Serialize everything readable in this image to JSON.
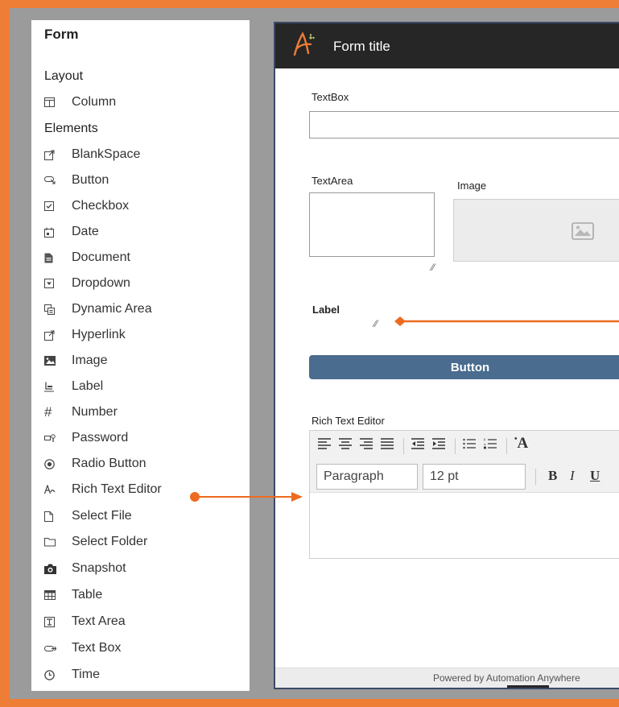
{
  "sidebar": {
    "title": "Form",
    "layout_label": "Layout",
    "layout_items": [
      {
        "label": "Column",
        "icon": "column-icon"
      }
    ],
    "elements_label": "Elements",
    "element_items": [
      {
        "label": "BlankSpace",
        "icon": "blankspace-icon"
      },
      {
        "label": "Button",
        "icon": "button-icon"
      },
      {
        "label": "Checkbox",
        "icon": "checkbox-icon"
      },
      {
        "label": "Date",
        "icon": "calendar-icon"
      },
      {
        "label": "Document",
        "icon": "document-icon"
      },
      {
        "label": "Dropdown",
        "icon": "dropdown-icon"
      },
      {
        "label": "Dynamic Area",
        "icon": "dynamic-area-icon"
      },
      {
        "label": "Hyperlink",
        "icon": "hyperlink-icon"
      },
      {
        "label": "Image",
        "icon": "image-icon"
      },
      {
        "label": "Label",
        "icon": "label-icon"
      },
      {
        "label": "Number",
        "icon": "hash-icon"
      },
      {
        "label": "Password",
        "icon": "password-icon"
      },
      {
        "label": "Radio Button",
        "icon": "radio-icon"
      },
      {
        "label": "Rich Text Editor",
        "icon": "rich-text-icon"
      },
      {
        "label": "Select File",
        "icon": "file-icon"
      },
      {
        "label": "Select Folder",
        "icon": "folder-icon"
      },
      {
        "label": "Snapshot",
        "icon": "camera-icon"
      },
      {
        "label": "Table",
        "icon": "table-icon"
      },
      {
        "label": "Text Area",
        "icon": "text-area-icon"
      },
      {
        "label": "Text Box",
        "icon": "text-box-icon"
      },
      {
        "label": "Time",
        "icon": "clock-icon"
      }
    ]
  },
  "form": {
    "title": "Form title",
    "textbox_label": "TextBox",
    "textarea_label": "TextArea",
    "image_label": "Image",
    "label_label": "Label",
    "button_label": "Button",
    "rte_label": "Rich Text Editor",
    "rte_paragraph": "Paragraph",
    "rte_font_size": "12 pt",
    "rte_bold": "B",
    "rte_italic": "I",
    "rte_underline": "U",
    "rte_font_glyph": "A",
    "footer": "Powered by Automation Anywhere"
  },
  "colors": {
    "frame": "#ee7d35",
    "background": "#9b9b9b",
    "header": "#262626",
    "button": "#4a6c8e",
    "annotation_arrow": "#ee6a1f"
  }
}
